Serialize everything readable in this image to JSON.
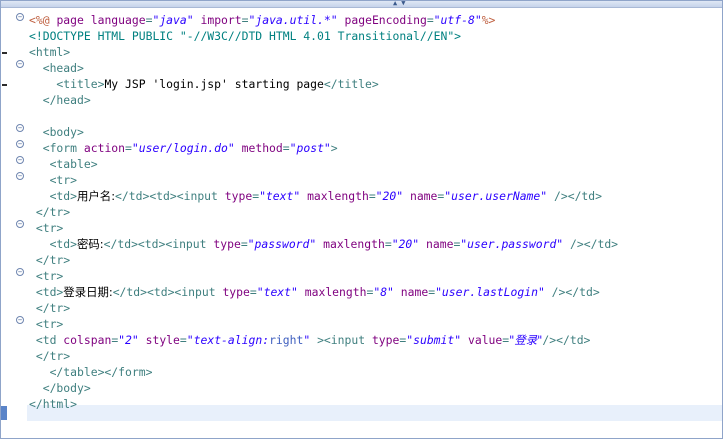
{
  "editor": {
    "lines": [
      [
        [
          "d",
          "<%@ "
        ],
        [
          "a",
          "page "
        ],
        [
          "a",
          "language"
        ],
        [
          "t",
          "="
        ],
        [
          "v",
          "\"java\""
        ],
        [
          "t",
          " "
        ],
        [
          "a",
          "import"
        ],
        [
          "t",
          "="
        ],
        [
          "v",
          "\"java.util.*\""
        ],
        [
          "t",
          " "
        ],
        [
          "a",
          "pageEncoding"
        ],
        [
          "t",
          "="
        ],
        [
          "v",
          "\"utf-8\""
        ],
        [
          "d",
          "%>"
        ]
      ],
      [
        [
          "p",
          "<!DOCTYPE HTML PUBLIC \"-//W3C//DTD HTML 4.01 Transitional//EN\">"
        ]
      ],
      [
        [
          "t",
          "<html>"
        ]
      ],
      [
        [
          "t",
          "  <head>"
        ]
      ],
      [
        [
          "t",
          "    <title>"
        ],
        [
          "x",
          "My JSP 'login.jsp' starting page"
        ],
        [
          "t",
          "</title>"
        ]
      ],
      [
        [
          "t",
          "  </head>"
        ]
      ],
      [
        [
          "x",
          ""
        ]
      ],
      [
        [
          "t",
          "  <body>"
        ]
      ],
      [
        [
          "t",
          "  <form "
        ],
        [
          "a",
          "action"
        ],
        [
          "t",
          "="
        ],
        [
          "v",
          "\"user/login.do\""
        ],
        [
          "t",
          " "
        ],
        [
          "a",
          "method"
        ],
        [
          "t",
          "="
        ],
        [
          "v",
          "\"post\""
        ],
        [
          "t",
          ">"
        ]
      ],
      [
        [
          "t",
          "   <table>"
        ]
      ],
      [
        [
          "t",
          "   <tr>"
        ]
      ],
      [
        [
          "t",
          "   <td>"
        ],
        [
          "c",
          "用户名:"
        ],
        [
          "t",
          "</td><td><input "
        ],
        [
          "a",
          "type"
        ],
        [
          "t",
          "="
        ],
        [
          "v",
          "\"text\""
        ],
        [
          "t",
          " "
        ],
        [
          "a",
          "maxlength"
        ],
        [
          "t",
          "="
        ],
        [
          "v",
          "\"20\""
        ],
        [
          "t",
          " "
        ],
        [
          "a",
          "name"
        ],
        [
          "t",
          "="
        ],
        [
          "v",
          "\"user.userName\""
        ],
        [
          "t",
          " /></td>"
        ]
      ],
      [
        [
          "t",
          " </tr>"
        ]
      ],
      [
        [
          "t",
          " <tr>"
        ]
      ],
      [
        [
          "t",
          "   <td>"
        ],
        [
          "c",
          "密码:"
        ],
        [
          "t",
          "</td><td><input "
        ],
        [
          "a",
          "type"
        ],
        [
          "t",
          "="
        ],
        [
          "v",
          "\"password\""
        ],
        [
          "t",
          " "
        ],
        [
          "a",
          "maxlength"
        ],
        [
          "t",
          "="
        ],
        [
          "v",
          "\"20\""
        ],
        [
          "t",
          " "
        ],
        [
          "a",
          "name"
        ],
        [
          "t",
          "="
        ],
        [
          "v",
          "\"user.password\""
        ],
        [
          "t",
          " /></td>"
        ]
      ],
      [
        [
          "t",
          " </tr>"
        ]
      ],
      [
        [
          "t",
          " <tr>"
        ]
      ],
      [
        [
          "t",
          " <td>"
        ],
        [
          "c",
          "登录日期:"
        ],
        [
          "t",
          "</td><td><input "
        ],
        [
          "a",
          "type"
        ],
        [
          "t",
          "="
        ],
        [
          "v",
          "\"text\""
        ],
        [
          "t",
          " "
        ],
        [
          "a",
          "maxlength"
        ],
        [
          "t",
          "="
        ],
        [
          "v",
          "\"8\""
        ],
        [
          "t",
          " "
        ],
        [
          "a",
          "name"
        ],
        [
          "t",
          "="
        ],
        [
          "v",
          "\"user.lastLogin\""
        ],
        [
          "t",
          " /></td>"
        ]
      ],
      [
        [
          "t",
          " </tr>"
        ]
      ],
      [
        [
          "t",
          " <tr>"
        ]
      ],
      [
        [
          "t",
          " <td "
        ],
        [
          "a",
          "colspan"
        ],
        [
          "t",
          "="
        ],
        [
          "v",
          "\"2\""
        ],
        [
          "t",
          " "
        ],
        [
          "a",
          "style"
        ],
        [
          "t",
          "="
        ],
        [
          "v",
          "\"text-align:"
        ],
        [
          "ja",
          "right"
        ],
        [
          "v",
          "\""
        ],
        [
          "t",
          " ><input "
        ],
        [
          "a",
          "type"
        ],
        [
          "t",
          "="
        ],
        [
          "v",
          "\"submit\""
        ],
        [
          "t",
          " "
        ],
        [
          "a",
          "value"
        ],
        [
          "t",
          "="
        ],
        [
          "cv",
          "\"登录\""
        ],
        [
          "t",
          "/></td>"
        ]
      ],
      [
        [
          "t",
          " </tr>"
        ]
      ],
      [
        [
          "t",
          "   </table></form>"
        ]
      ],
      [
        [
          "t",
          "  </body>"
        ]
      ],
      [
        [
          "t",
          "</html>"
        ]
      ],
      [
        [
          "x",
          ""
        ]
      ]
    ]
  }
}
